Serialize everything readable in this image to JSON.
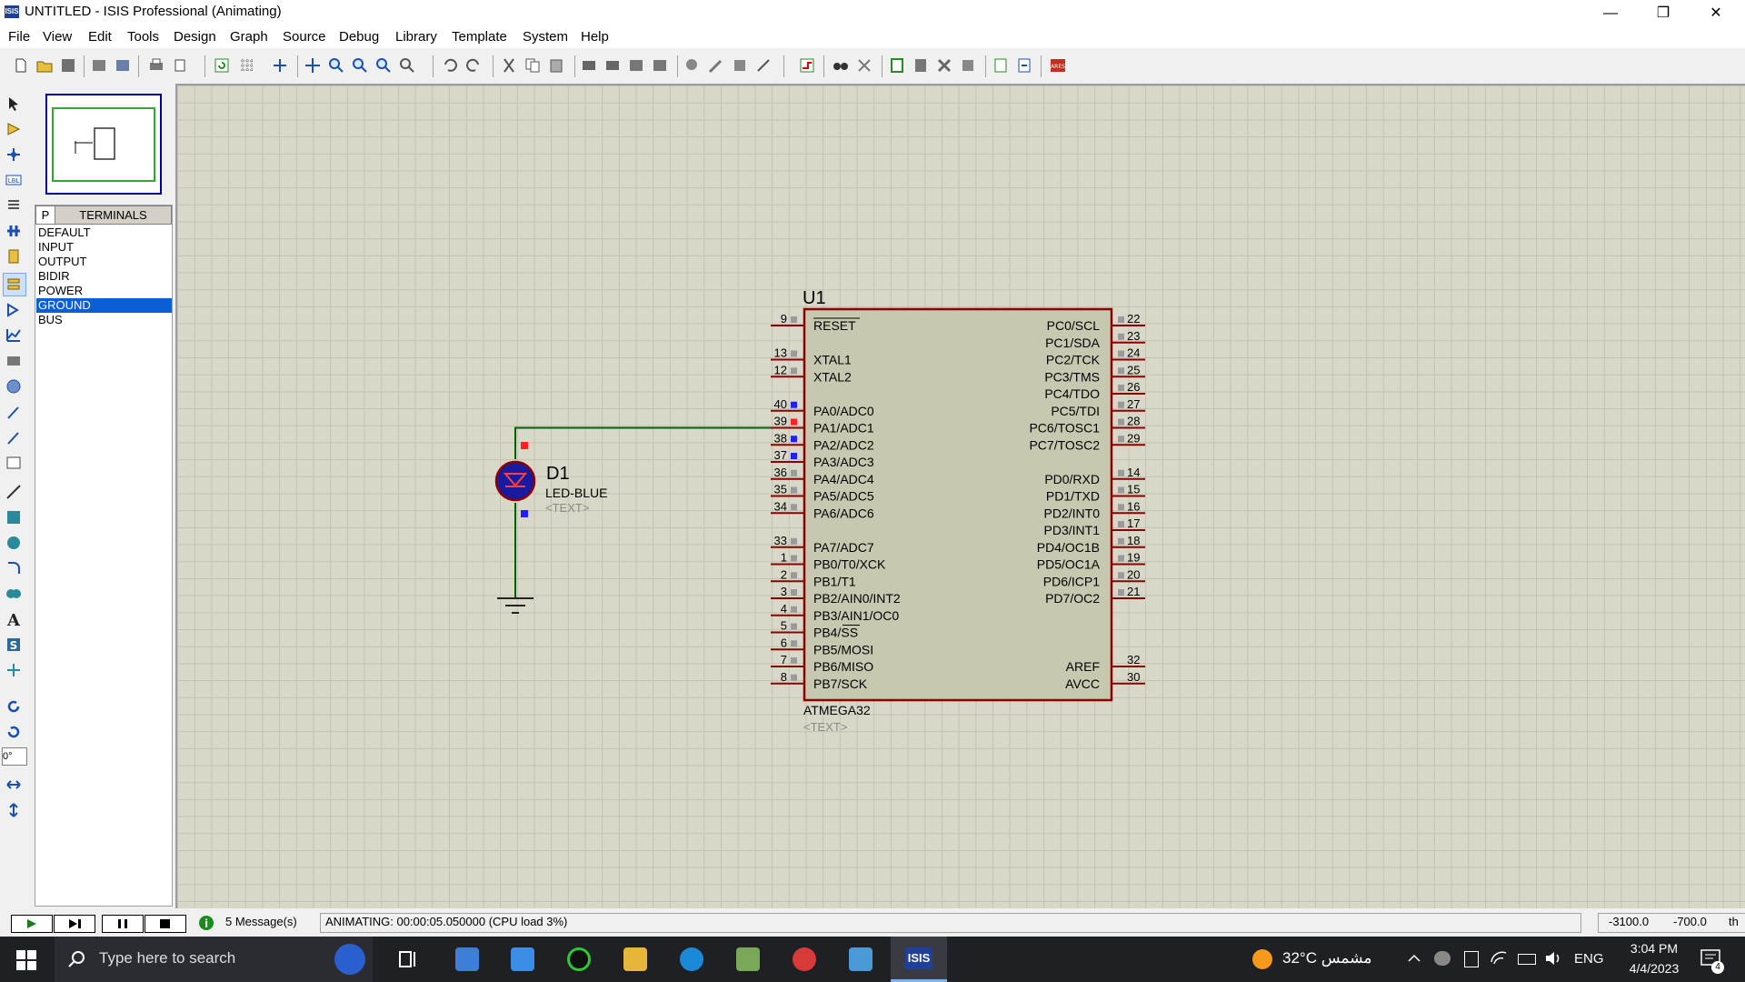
{
  "window": {
    "title": "UNTITLED - ISIS Professional (Animating)",
    "app_icon": "ISIS",
    "minimize": "—",
    "restore": "❐",
    "close": "✕"
  },
  "menu": [
    "File",
    "View",
    "Edit",
    "Tools",
    "Design",
    "Graph",
    "Source",
    "Debug",
    "Library",
    "Template",
    "System",
    "Help"
  ],
  "selector": {
    "mode_button": "P",
    "header": "TERMINALS",
    "items": [
      "DEFAULT",
      "INPUT",
      "OUTPUT",
      "BIDIR",
      "POWER",
      "GROUND",
      "BUS"
    ],
    "selected_index": 5
  },
  "rotation_value": "0°",
  "schematic": {
    "chip": {
      "ref": "U1",
      "part": "ATMEGA32",
      "text": "<TEXT>",
      "left_pins": [
        {
          "num": "9",
          "name": "RESET"
        },
        {
          "num": "13",
          "name": "XTAL1"
        },
        {
          "num": "12",
          "name": "XTAL2"
        },
        {
          "num": "40",
          "name": "PA0/ADC0"
        },
        {
          "num": "39",
          "name": "PA1/ADC1"
        },
        {
          "num": "38",
          "name": "PA2/ADC2"
        },
        {
          "num": "37",
          "name": "PA3/ADC3"
        },
        {
          "num": "36",
          "name": "PA4/ADC4"
        },
        {
          "num": "35",
          "name": "PA5/ADC5"
        },
        {
          "num": "34",
          "name": "PA6/ADC6"
        },
        {
          "num": "33",
          "name": "PA7/ADC7"
        },
        {
          "num": "1",
          "name": "PB0/T0/XCK"
        },
        {
          "num": "2",
          "name": "PB1/T1"
        },
        {
          "num": "3",
          "name": "PB2/AIN0/INT2"
        },
        {
          "num": "4",
          "name": "PB3/AIN1/OC0"
        },
        {
          "num": "5",
          "name": "PB4/SS"
        },
        {
          "num": "6",
          "name": "PB5/MOSI"
        },
        {
          "num": "7",
          "name": "PB6/MISO"
        },
        {
          "num": "8",
          "name": "PB7/SCK"
        }
      ],
      "right_pins": [
        {
          "num": "22",
          "name": "PC0/SCL"
        },
        {
          "num": "23",
          "name": "PC1/SDA"
        },
        {
          "num": "24",
          "name": "PC2/TCK"
        },
        {
          "num": "25",
          "name": "PC3/TMS"
        },
        {
          "num": "26",
          "name": "PC4/TDO"
        },
        {
          "num": "27",
          "name": "PC5/TDI"
        },
        {
          "num": "28",
          "name": "PC6/TOSC1"
        },
        {
          "num": "29",
          "name": "PC7/TOSC2"
        },
        {
          "num": "14",
          "name": "PD0/RXD"
        },
        {
          "num": "15",
          "name": "PD1/TXD"
        },
        {
          "num": "16",
          "name": "PD2/INT0"
        },
        {
          "num": "17",
          "name": "PD3/INT1"
        },
        {
          "num": "18",
          "name": "PD4/OC1B"
        },
        {
          "num": "19",
          "name": "PD5/OC1A"
        },
        {
          "num": "20",
          "name": "PD6/ICP1"
        },
        {
          "num": "21",
          "name": "PD7/OC2"
        },
        {
          "num": "32",
          "name": "AREF"
        },
        {
          "num": "30",
          "name": "AVCC"
        }
      ]
    },
    "led": {
      "ref": "D1",
      "part": "LED-BLUE",
      "text": "<TEXT>"
    },
    "colors": {
      "wire": "#006400",
      "chip_border": "#8b0000",
      "chip_fill": "#c8c7b0",
      "pin_high": "#ff2020",
      "pin_low": "#2020ff",
      "led_body": "#1a1aa0"
    }
  },
  "status": {
    "messages": "5 Message(s)",
    "animating": "ANIMATING: 00:00:05.050000 (CPU load 3%)",
    "x": "-3100.0",
    "y": "-700.0",
    "units": "th"
  },
  "taskbar": {
    "search_placeholder": "Type here to search",
    "weather": "32°C مشمس",
    "language": "ENG",
    "time": "3:04 PM",
    "date": "4/4/2023",
    "notifications": "4",
    "active_app": "ISIS"
  }
}
